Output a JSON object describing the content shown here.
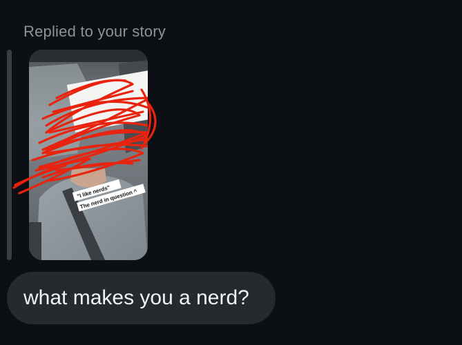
{
  "reply": {
    "label": "Replied to your story"
  },
  "story": {
    "sticker_line_1": "\"I like nerds\"",
    "sticker_line_2": "The nerd in question ^"
  },
  "message": {
    "text": "what makes you a nerd?"
  },
  "colors": {
    "background": "#0c0f13",
    "bubble": "#26292e",
    "reply_bar": "#3a3d42",
    "scribble": "#e8230e",
    "label": "#8e9299"
  }
}
